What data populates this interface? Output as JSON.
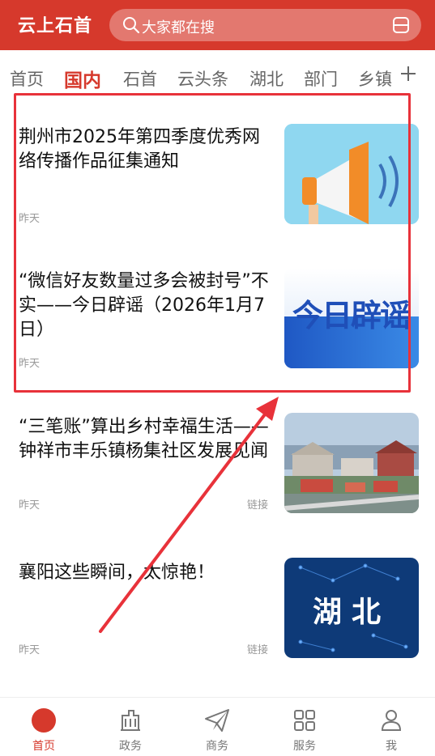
{
  "header": {
    "app_title": "云上石首",
    "search_placeholder": "大家都在搜"
  },
  "tabs": [
    {
      "label": "首页",
      "active": false
    },
    {
      "label": "国内",
      "active": true
    },
    {
      "label": "石首",
      "active": false
    },
    {
      "label": "云头条",
      "active": false
    },
    {
      "label": "湖北",
      "active": false
    },
    {
      "label": "部门",
      "active": false
    },
    {
      "label": "乡镇",
      "active": false
    }
  ],
  "articles": [
    {
      "title": "荆州市2025年第四季度优秀网络传播作品征集通知",
      "time": "昨天",
      "link": "",
      "thumb_icon": "megaphone-icon"
    },
    {
      "title": "“微信好友数量过多会被封号”不实——今日辟谣（2026年1月7日）",
      "time": "昨天",
      "link": "",
      "thumb_text": "今日辟谣"
    },
    {
      "title": "“三笔账”算出乡村幸福生活——钟祥市丰乐镇杨集社区发展见闻",
      "time": "昨天",
      "link": "链接"
    },
    {
      "title": "襄阳这些瞬间，太惊艳！",
      "time": "昨天",
      "link": "链接",
      "thumb_text": "湖北"
    }
  ],
  "bottom_nav": [
    {
      "label": "首页",
      "icon": "home-dot-icon",
      "active": true
    },
    {
      "label": "政务",
      "icon": "building-icon",
      "active": false
    },
    {
      "label": "商务",
      "icon": "paper-plane-icon",
      "active": false
    },
    {
      "label": "服务",
      "icon": "grid-icon",
      "active": false
    },
    {
      "label": "我",
      "icon": "user-icon",
      "active": false
    }
  ],
  "colors": {
    "brand": "#d6392c",
    "annotation": "#e8323a"
  }
}
